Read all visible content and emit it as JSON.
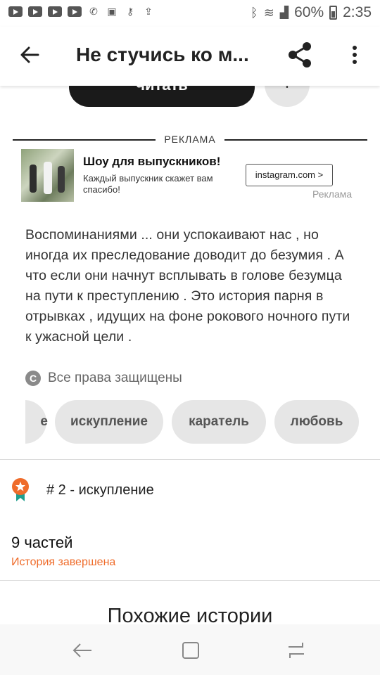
{
  "status_bar": {
    "battery": "60%",
    "time": "2:35"
  },
  "app_bar": {
    "title": "Не стучись ко м..."
  },
  "actions": {
    "read_label": "читать",
    "add_label": "+"
  },
  "ad": {
    "header": "РЕКЛАМА",
    "title": "Шоу для выпускников!",
    "description": "Каждый выпускник скажет вам спасибо!",
    "button": "instagram.com >",
    "tag": "Реклама"
  },
  "story": {
    "description": "Воспоминаниями ... они успокаивают нас , но иногда их преследование доводит до безумия . А что если они начнут всплывать в голове безумца на пути к преступлению . Это история парня в отрывках , идущих на фоне рокового ночного пути к ужасной цели .",
    "copyright_icon": "C",
    "copyright": "Все права защищены",
    "tags": [
      "е",
      "искупление",
      "каратель",
      "любовь"
    ]
  },
  "ranking": {
    "label": "# 2 - искупление"
  },
  "parts": {
    "count": "9 частей",
    "status": "История завершена"
  },
  "similar": {
    "title": "Похожие истории"
  },
  "colors": {
    "accent": "#ef6c2b",
    "badge_teal": "#1f9e8e",
    "dark_button": "#1a1a1a"
  }
}
